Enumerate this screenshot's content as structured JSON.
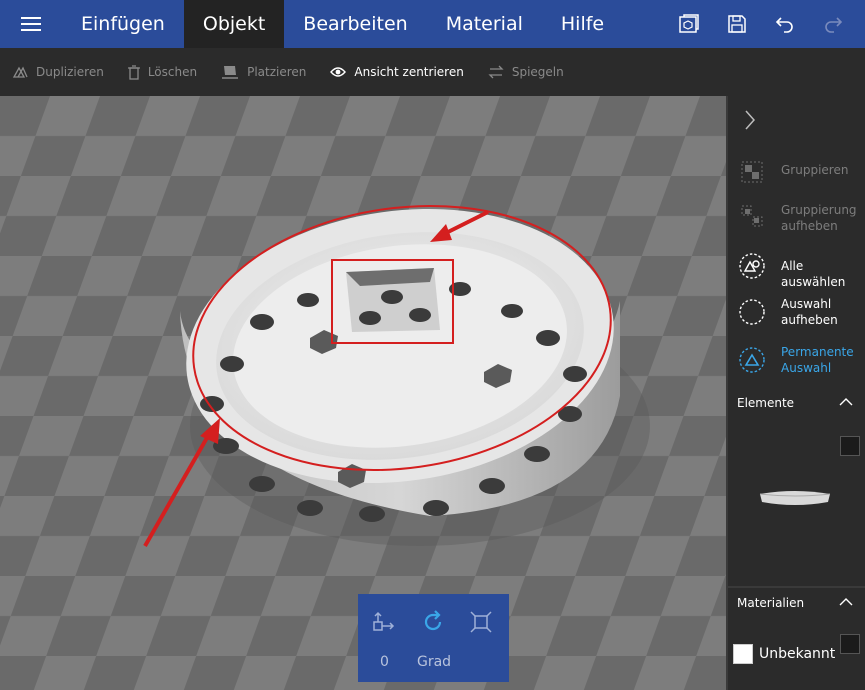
{
  "menubar": {
    "items": [
      {
        "label": "Einfügen",
        "active": false
      },
      {
        "label": "Objekt",
        "active": true
      },
      {
        "label": "Bearbeiten",
        "active": false
      },
      {
        "label": "Material",
        "active": false
      },
      {
        "label": "Hilfe",
        "active": false
      }
    ],
    "right_icons": [
      "3d-view-icon",
      "save-icon",
      "undo-icon",
      "redo-icon"
    ]
  },
  "toolbar": {
    "items": [
      {
        "label": "Duplizieren",
        "icon": "duplicate-icon",
        "enabled": false
      },
      {
        "label": "Löschen",
        "icon": "trash-icon",
        "enabled": false
      },
      {
        "label": "Platzieren",
        "icon": "place-icon",
        "enabled": false
      },
      {
        "label": "Ansicht zentrieren",
        "icon": "eye-icon",
        "enabled": true
      },
      {
        "label": "Spiegeln",
        "icon": "mirror-icon",
        "enabled": false
      }
    ]
  },
  "sidepanel": {
    "actions": [
      {
        "label": "Gruppieren",
        "icon": "group-icon",
        "state": "disabled"
      },
      {
        "label": "Gruppierung aufheben",
        "icon": "ungroup-icon",
        "state": "disabled"
      },
      {
        "label": "Alle auswählen",
        "icon": "select-all-icon",
        "state": "enabled"
      },
      {
        "label": "Auswahl aufheben",
        "icon": "deselect-icon",
        "state": "enabled"
      },
      {
        "label": "Permanente Auswahl",
        "icon": "permanent-selection-icon",
        "state": "accent"
      }
    ],
    "elements_title": "Elemente",
    "materials_title": "Materialien",
    "material_name": "Unbekannt"
  },
  "rotation": {
    "value": "0",
    "unit": "Grad"
  },
  "colors": {
    "menubar": "#2b4c9a",
    "toolbar": "#2b2b2b",
    "accent": "#3aa6e8",
    "annotation": "#d41f1f"
  }
}
